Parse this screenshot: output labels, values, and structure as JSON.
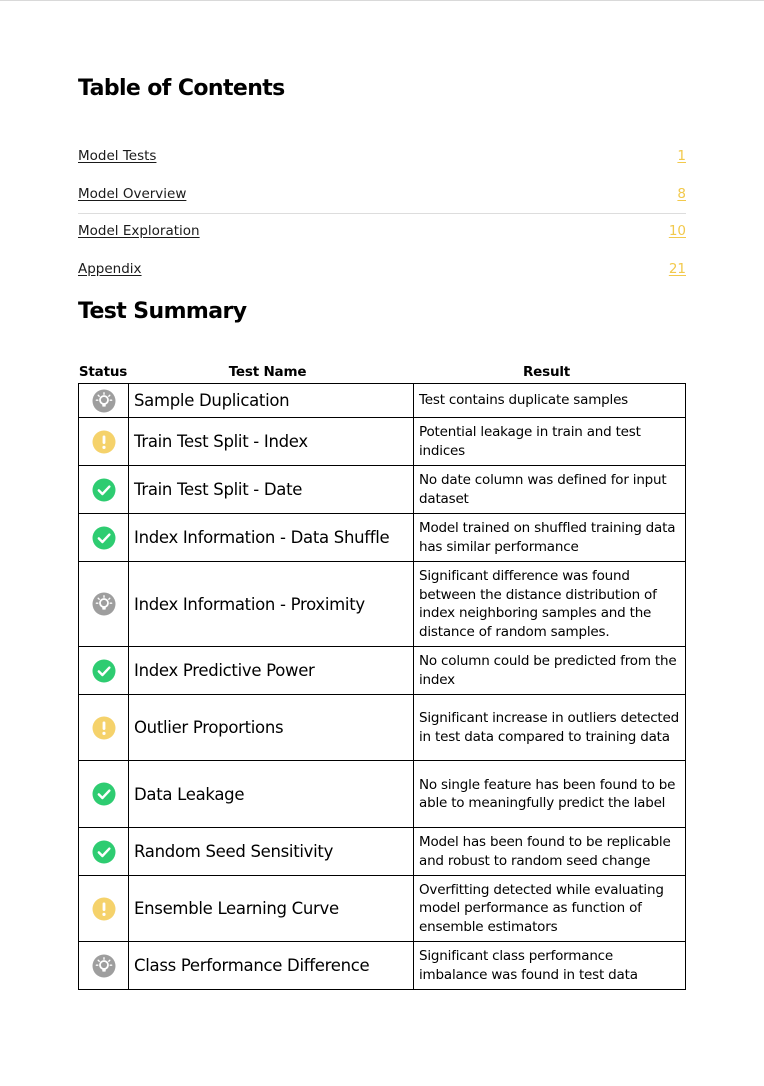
{
  "toc": {
    "title": "Table of Contents",
    "items": [
      {
        "label": "Model Tests",
        "page": "1"
      },
      {
        "label": "Model Overview",
        "page": "8"
      },
      {
        "label": "Model Exploration",
        "page": "10"
      },
      {
        "label": "Appendix",
        "page": "21"
      }
    ]
  },
  "summary": {
    "title": "Test Summary",
    "headers": {
      "status": "Status",
      "name": "Test Name",
      "result": "Result"
    },
    "status_colors": {
      "info": "#9e9e9e",
      "warning": "#f5d26b",
      "pass": "#2ecc71"
    },
    "rows": [
      {
        "status": "info",
        "name": "Sample Duplication",
        "result": "Test contains duplicate samples",
        "h": 34
      },
      {
        "status": "warning",
        "name": "Train Test Split - Index",
        "result": "Potential leakage in train and test indices",
        "h": 48
      },
      {
        "status": "pass",
        "name": "Train Test Split - Date",
        "result": "No date column was defined for input dataset",
        "h": 48
      },
      {
        "status": "pass",
        "name": "Index Information - Data Shuffle",
        "result": "Model trained on shuffled training data has similar performance",
        "h": 48
      },
      {
        "status": "info",
        "name": "Index Information - Proximity",
        "result": "Significant difference was found between the distance distribution of index neighboring samples and the distance of random samples.",
        "h": 85
      },
      {
        "status": "pass",
        "name": "Index Predictive Power",
        "result": "No column could be predicted from the index",
        "h": 48
      },
      {
        "status": "warning",
        "name": "Outlier Proportions",
        "result": "Significant increase in outliers detected in test data compared to training data",
        "h": 66
      },
      {
        "status": "pass",
        "name": "Data Leakage",
        "result": "No single feature has been found to be able to meaningfully predict the label",
        "h": 67
      },
      {
        "status": "pass",
        "name": "Random Seed Sensitivity",
        "result": "Model has been found to be replicable and robust to random seed change",
        "h": 48
      },
      {
        "status": "warning",
        "name": "Ensemble Learning Curve",
        "result": "Overfitting detected while evaluating model performance as function of ensemble estimators",
        "h": 66
      },
      {
        "status": "info",
        "name": "Class Performance Difference",
        "result": "Significant class performance imbalance was found in test data",
        "h": 48
      }
    ]
  }
}
